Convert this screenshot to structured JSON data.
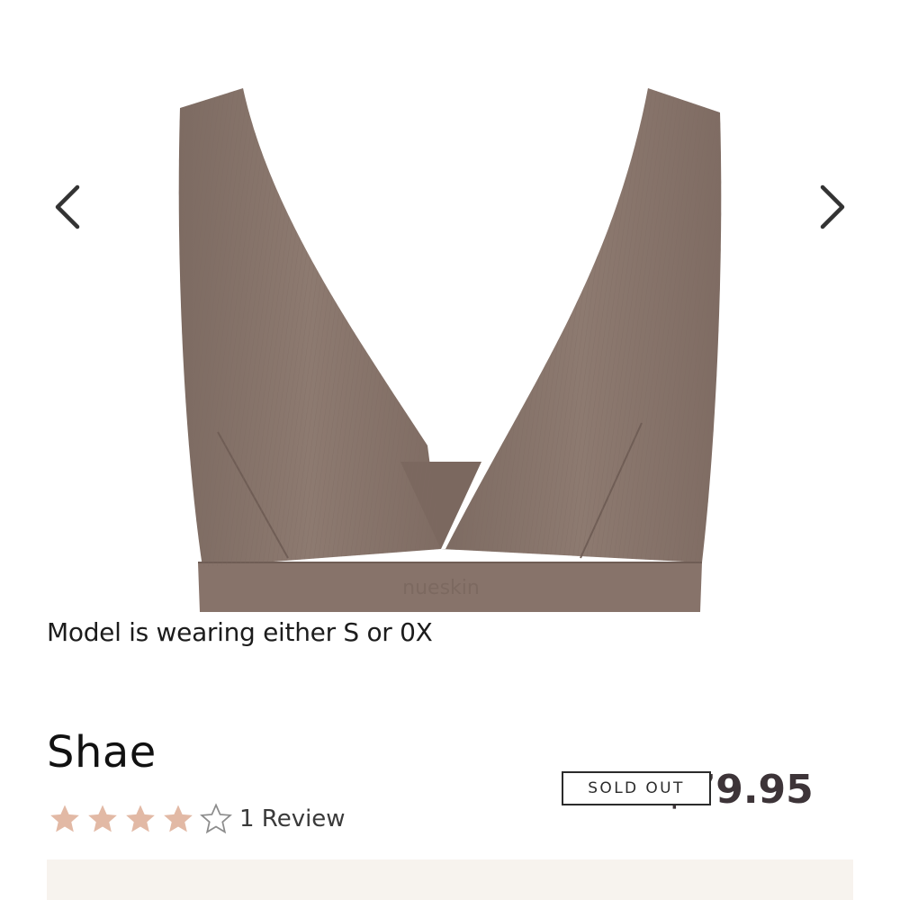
{
  "product": {
    "caption": "Model is wearing either S or 0X",
    "title": "Shae",
    "rating": {
      "value": 4,
      "max": 5
    },
    "review_text": "1 Review",
    "price": "$79.95",
    "sold_out_label": "SOLD OUT",
    "image_brand_mark": "nueskin"
  },
  "colors": {
    "star_filled": "#e2b9a5",
    "star_outline": "#8c8c8c",
    "garment": "#8a766c",
    "price": "#3d3438"
  },
  "icons": {
    "prev": "chevron-left-icon",
    "next": "chevron-right-icon",
    "star": "star-icon"
  }
}
